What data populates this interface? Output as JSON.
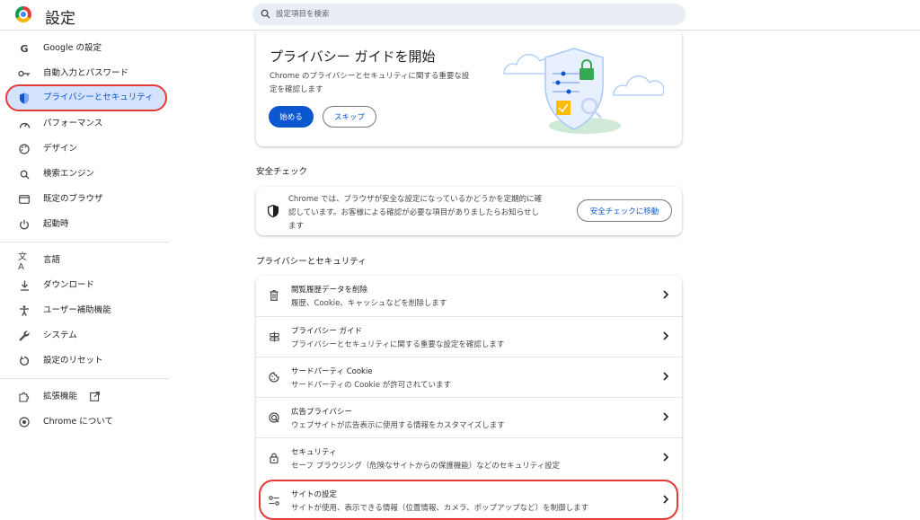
{
  "app": {
    "title": "設定"
  },
  "search": {
    "placeholder": "設定項目を検索"
  },
  "sidebar": {
    "items": [
      {
        "label": "Google の設定"
      },
      {
        "label": "自動入力とパスワード"
      },
      {
        "label": "プライバシーとセキュリティ"
      },
      {
        "label": "パフォーマンス"
      },
      {
        "label": "デザイン"
      },
      {
        "label": "検索エンジン"
      },
      {
        "label": "既定のブラウザ"
      },
      {
        "label": "起動時"
      },
      {
        "label": "言語"
      },
      {
        "label": "ダウンロード"
      },
      {
        "label": "ユーザー補助機能"
      },
      {
        "label": "システム"
      },
      {
        "label": "設定のリセット"
      },
      {
        "label": "拡張機能"
      },
      {
        "label": "Chrome について"
      }
    ]
  },
  "privacy_guide": {
    "title": "プライバシー ガイドを開始",
    "desc_line1": "Chrome のプライバシーとセキュリティに関する重要な設",
    "desc_line2": "定を確認します",
    "start_label": "始める",
    "skip_label": "スキップ"
  },
  "safety_check": {
    "heading": "安全チェック",
    "text_line1": "Chrome では、ブラウザが安全な設定になっているかどうかを定期的に確",
    "text_line2": "認しています。お客様による確認が必要な項目がありましたらお知らせし",
    "text_line3": "ます",
    "button_label": "安全チェックに移動"
  },
  "privacy_section": {
    "heading": "プライバシーとセキュリティ",
    "rows": [
      {
        "title": "閲覧履歴データを削除",
        "subtitle": "履歴、Cookie、キャッシュなどを削除します"
      },
      {
        "title": "プライバシー ガイド",
        "subtitle": "プライバシーとセキュリティに関する重要な設定を確認します"
      },
      {
        "title": "サードパーティ Cookie",
        "subtitle": "サードパーティの Cookie が許可されています"
      },
      {
        "title": "広告プライバシー",
        "subtitle": "ウェブサイトが広告表示に使用する情報をカスタマイズします"
      },
      {
        "title": "セキュリティ",
        "subtitle": "セーフ ブラウジング（危険なサイトからの保護機能）などのセキュリティ設定"
      },
      {
        "title": "サイトの設定",
        "subtitle": "サイトが使用、表示できる情報（位置情報、カメラ、ポップアップなど）を制御します"
      }
    ]
  },
  "colors": {
    "accent": "#0b57d0",
    "active_bg": "#d3e3fd",
    "highlight_outline": "#e53935"
  }
}
